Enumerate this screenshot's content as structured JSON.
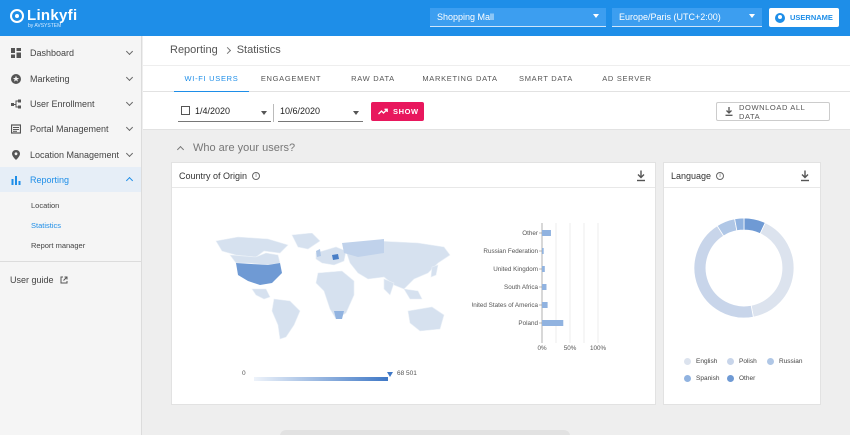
{
  "app": {
    "logo": "Linkyfi",
    "logo_sub": "by AVSYSTEM"
  },
  "topbar": {
    "venue_select": "Shopping Mall",
    "timezone_select": "Europe/Paris (UTC+2:00)",
    "user_label": "USERNAME"
  },
  "sidebar": {
    "items": [
      {
        "label": "Dashboard",
        "icon": "dashboard-icon"
      },
      {
        "label": "Marketing",
        "icon": "star-badge-icon"
      },
      {
        "label": "User Enrollment",
        "icon": "share-icon"
      },
      {
        "label": "Portal Management",
        "icon": "portal-icon"
      },
      {
        "label": "Location Management",
        "icon": "location-pin-icon"
      },
      {
        "label": "Reporting",
        "icon": "bar-chart-icon"
      }
    ],
    "subitems": [
      "Location",
      "Statistics",
      "Report manager"
    ],
    "active_subitem": "Statistics",
    "user_guide": "User guide"
  },
  "breadcrumb": {
    "parent": "Reporting",
    "current": "Statistics"
  },
  "tabs": [
    "WI-FI USERS",
    "ENGAGEMENT",
    "RAW DATA",
    "MARKETING DATA",
    "SMART DATA",
    "AD SERVER"
  ],
  "filters": {
    "date_from": "1/4/2020",
    "date_to": "10/6/2020",
    "show_label": "SHOW",
    "download_all_label": "DOWNLOAD ALL DATA"
  },
  "section": {
    "title": "Who are your users?"
  },
  "country_card": {
    "title": "Country of Origin",
    "scale_min": "0",
    "scale_max": "68 501"
  },
  "language_card": {
    "title": "Language"
  },
  "colors": {
    "brand": "#1e8ee8",
    "accent": "#e8175d"
  },
  "chart_data": [
    {
      "type": "bar",
      "orientation": "horizontal",
      "categories": [
        "Other",
        "Russian Federation",
        "United Kingdom",
        "South Africa",
        "United States of America",
        "Poland"
      ],
      "values": [
        16,
        3,
        5,
        8,
        10,
        38
      ],
      "xticks": [
        "0%",
        "50%",
        "100%"
      ],
      "xlim": [
        0,
        100
      ]
    },
    {
      "type": "pie",
      "style": "donut",
      "labels": [
        "English",
        "Polish",
        "Russian",
        "Spanish",
        "Other"
      ],
      "values": [
        40,
        44,
        6,
        3,
        7
      ],
      "colors": [
        "#dce3ee",
        "#c8d5ea",
        "#b0c7e6",
        "#91b3e0",
        "#6f9ad4"
      ],
      "legend": "bottom"
    }
  ]
}
